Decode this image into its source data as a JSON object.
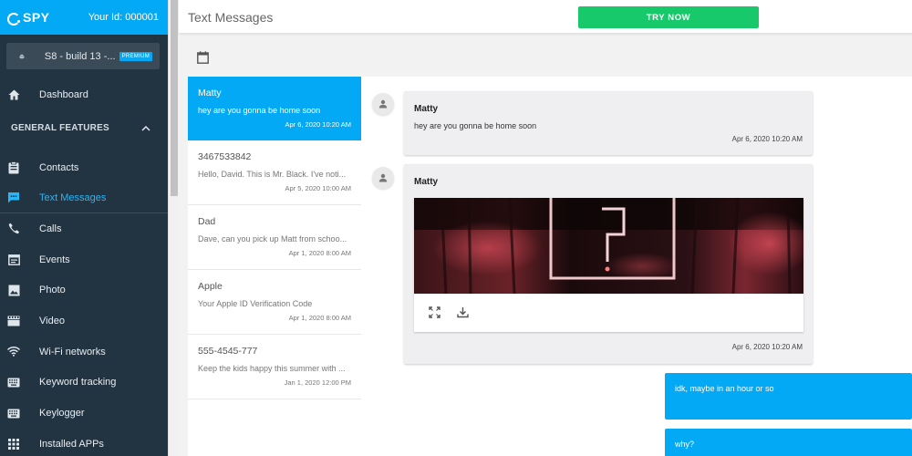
{
  "brand": {
    "logo_text": "SPY",
    "user_id": "Your Id: 000001"
  },
  "device": {
    "name": "S8 - build 13 -...",
    "badge": "PREMIUM"
  },
  "nav": {
    "dashboard": "Dashboard",
    "section_title": "GENERAL FEATURES",
    "items": [
      {
        "label": "Contacts",
        "icon": "clipboard-icon"
      },
      {
        "label": "Text Messages",
        "icon": "chat-icon",
        "active": true
      },
      {
        "label": "Calls",
        "icon": "phone-icon"
      },
      {
        "label": "Events",
        "icon": "calendar-icon"
      },
      {
        "label": "Photo",
        "icon": "image-icon"
      },
      {
        "label": "Video",
        "icon": "film-icon"
      },
      {
        "label": "Wi-Fi networks",
        "icon": "wifi-icon"
      },
      {
        "label": "Keyword tracking",
        "icon": "keyboard-icon"
      },
      {
        "label": "Keylogger",
        "icon": "keyboard-icon"
      },
      {
        "label": "Installed APPs",
        "icon": "apps-grid-icon"
      }
    ]
  },
  "header": {
    "title": "Text Messages",
    "try_now": "TRY NOW"
  },
  "conversations": [
    {
      "name": "Matty",
      "preview": "hey are you gonna be home soon",
      "date": "Apr 6, 2020 10:20 AM",
      "active": true
    },
    {
      "name": "3467533842",
      "preview": "Hello, David. This is Mr. Black. I've noti...",
      "date": "Apr 5, 2020 10:00 AM"
    },
    {
      "name": "Dad",
      "preview": "Dave, can you pick up Matt from schoo...",
      "date": "Apr 1, 2020 8:00 AM"
    },
    {
      "name": "Apple",
      "preview": "Your Apple ID Verification Code",
      "date": "Apr 1, 2020 8:00 AM"
    },
    {
      "name": "555-4545-777",
      "preview": "Keep the kids happy this summer with ...",
      "date": "Jan 1, 2020 12:00 PM"
    }
  ],
  "messages": [
    {
      "sender": "Matty",
      "text": "hey are you gonna be home soon",
      "date": "Apr 6, 2020 10:20 AM"
    },
    {
      "sender": "Matty",
      "date": "Apr 6, 2020 10:20 AM",
      "has_image": true
    }
  ],
  "outgoing": [
    {
      "text": "idk, maybe in an hour or so"
    },
    {
      "text": "why?"
    }
  ],
  "colors": {
    "accent": "#03a9f4",
    "sidebar": "#223342",
    "try_button": "#18c96b"
  }
}
